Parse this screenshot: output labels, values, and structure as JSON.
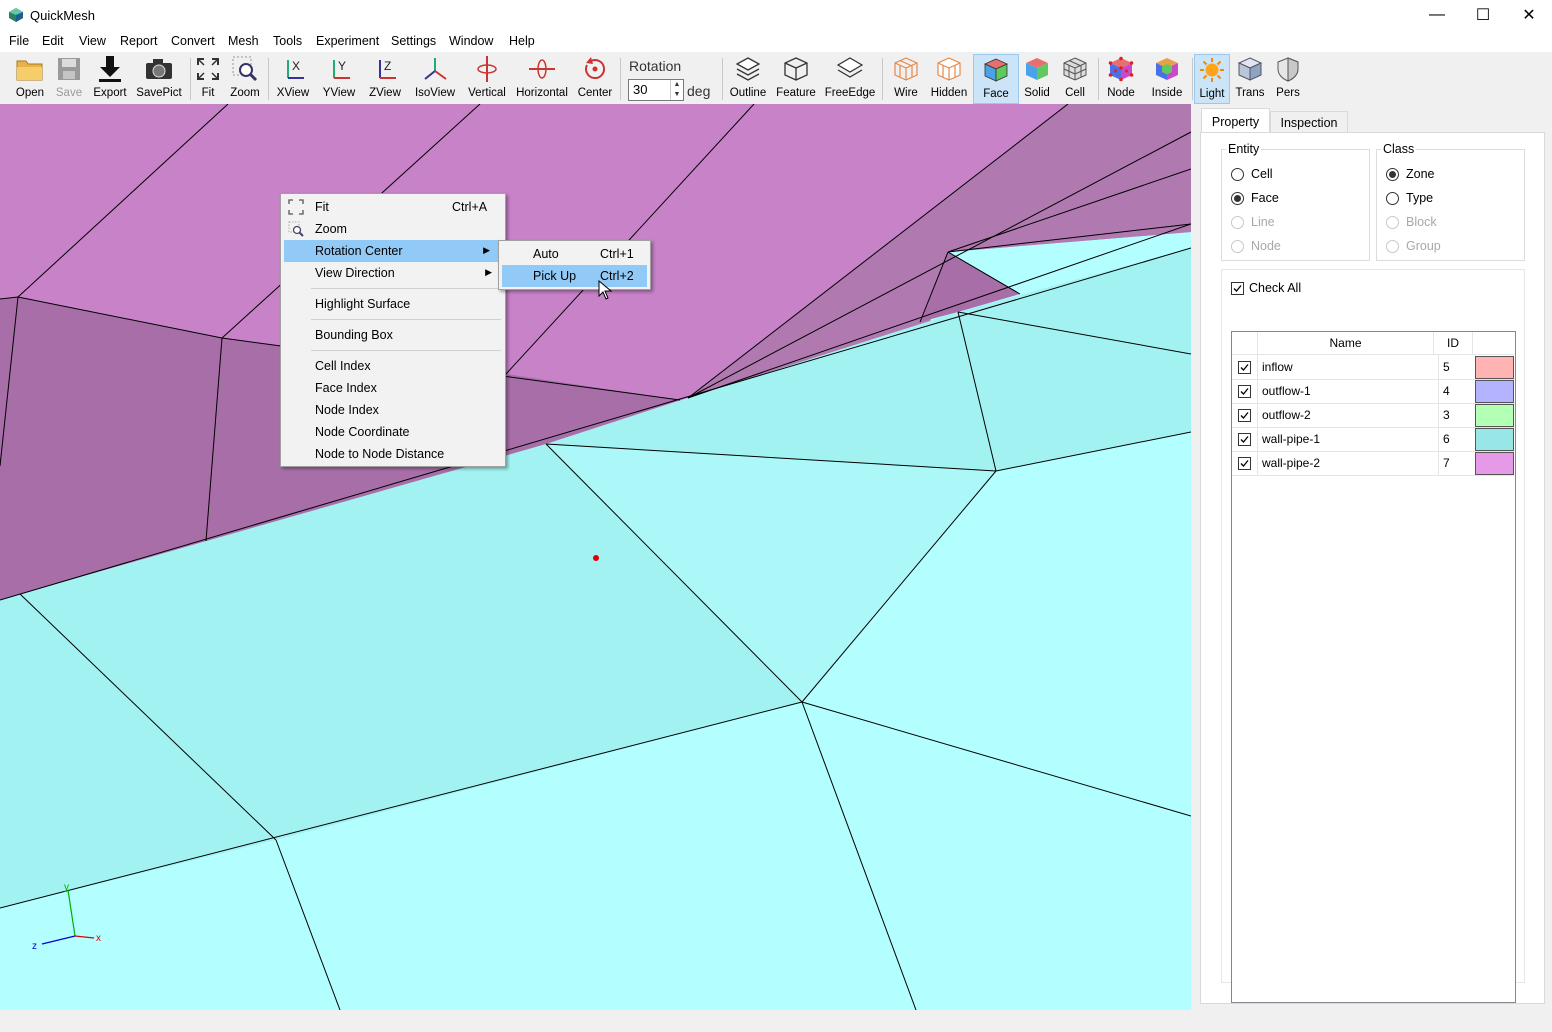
{
  "app": {
    "title": "QuickMesh"
  },
  "window_controls": {
    "minimize": "—",
    "maximize": "☐",
    "close": "✕"
  },
  "menubar": [
    "File",
    "Edit",
    "View",
    "Report",
    "Convert",
    "Mesh",
    "Tools",
    "Experiment",
    "Settings",
    "Window",
    "Help"
  ],
  "toolbar": {
    "open": "Open",
    "save": "Save",
    "export": "Export",
    "savepict": "SavePict",
    "fit": "Fit",
    "zoom": "Zoom",
    "xview": "XView",
    "yview": "YView",
    "zview": "ZView",
    "isoview": "IsoView",
    "vertical": "Vertical",
    "horizontal": "Horizontal",
    "center": "Center",
    "rotation_label": "Rotation",
    "rotation_value": "30",
    "rotation_unit": "deg",
    "outline": "Outline",
    "feature": "Feature",
    "freeedge": "FreeEdge",
    "wire": "Wire",
    "hidden": "Hidden",
    "face": "Face",
    "solid": "Solid",
    "cell": "Cell",
    "node": "Node",
    "inside": "Inside",
    "light": "Light",
    "trans": "Trans",
    "pers": "Pers"
  },
  "context_menu": {
    "fit": {
      "label": "Fit",
      "shortcut": "Ctrl+A"
    },
    "zoom": {
      "label": "Zoom"
    },
    "rotation_center": {
      "label": "Rotation Center"
    },
    "view_direction": {
      "label": "View Direction"
    },
    "highlight_surface": "Highlight Surface",
    "bounding_box": "Bounding Box",
    "cell_index": "Cell Index",
    "face_index": "Face Index",
    "node_index": "Node Index",
    "node_coordinate": "Node Coordinate",
    "node_to_node_distance": "Node to Node Distance"
  },
  "submenu": {
    "auto": {
      "label": "Auto",
      "shortcut": "Ctrl+1"
    },
    "pickup": {
      "label": "Pick Up",
      "shortcut": "Ctrl+2"
    }
  },
  "axes": {
    "y": "y",
    "z": "z",
    "x": "x"
  },
  "panel": {
    "tabs": [
      "Property",
      "Inspection"
    ],
    "active_tab": "Property",
    "entity": {
      "title": "Entity",
      "options": [
        "Cell",
        "Face",
        "Line",
        "Node"
      ],
      "selected": "Face"
    },
    "class": {
      "title": "Class",
      "options": [
        "Zone",
        "Type",
        "Block",
        "Group"
      ],
      "selected": "Zone"
    },
    "check_all": "Check All",
    "table": {
      "headers": [
        "Name",
        "ID"
      ],
      "rows": [
        {
          "name": "inflow",
          "id": "5",
          "color": "#ffb3b3"
        },
        {
          "name": "outflow-1",
          "id": "4",
          "color": "#b3b3ff"
        },
        {
          "name": "outflow-2",
          "id": "3",
          "color": "#b3ffb3"
        },
        {
          "name": "wall-pipe-1",
          "id": "6",
          "color": "#99e6e6"
        },
        {
          "name": "wall-pipe-2",
          "id": "7",
          "color": "#e699e6"
        }
      ]
    }
  },
  "colors": {
    "mesh_pink": "#c882c8",
    "mesh_pink_dark": "#a86ea8",
    "mesh_cyan": "#b3ffff",
    "mesh_cyan_shade": "#a3f2f2",
    "highlight": "#91c9f7",
    "active_tool": "#cce4f7"
  }
}
